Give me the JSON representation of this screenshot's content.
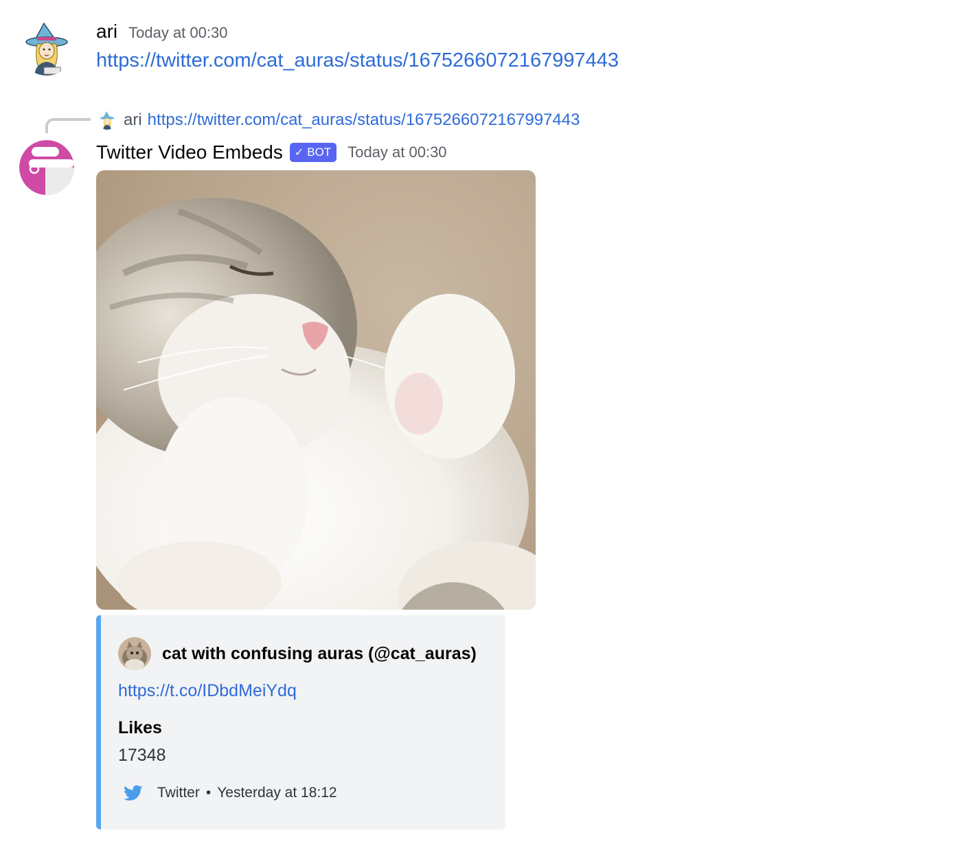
{
  "message1": {
    "author": "ari",
    "timestamp": "Today at 00:30",
    "content_link": "https://twitter.com/cat_auras/status/1675266072167997443"
  },
  "reply": {
    "author": "ari",
    "link": "https://twitter.com/cat_auras/status/1675266072167997443"
  },
  "message2": {
    "author": "Twitter Video Embeds",
    "bot_tag": "BOT",
    "bot_check": "✓",
    "timestamp": "Today at 00:30"
  },
  "embed": {
    "accent_color": "#58a6f0",
    "author_name": "cat with confusing auras (@cat_auras)",
    "description_link": "https://t.co/IDbdMeiYdq",
    "field_name": "Likes",
    "field_value": "17348",
    "footer_text": "Twitter",
    "footer_separator": "•",
    "footer_timestamp": "Yesterday at 18:12",
    "footer_icon": "twitter-bird-icon"
  },
  "colors": {
    "link": "#2e6bd8",
    "bot_tag": "#5865f2",
    "bot_avatar": "#cf4aa5"
  }
}
